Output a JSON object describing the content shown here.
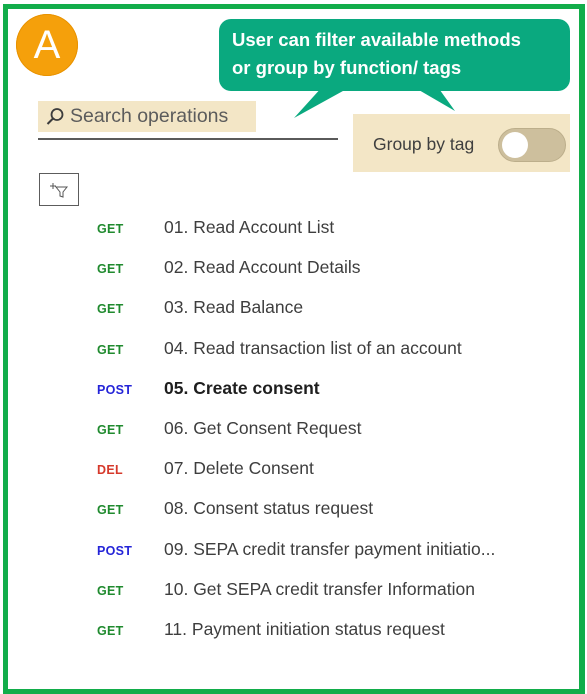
{
  "colors": {
    "frame": "#12ad4a",
    "badge": "#f5a00b",
    "callout": "#0aa97f",
    "highlight": "#f3e6c6",
    "method_get": "#1f8a2e",
    "method_post": "#2424d8",
    "method_del": "#d6392b"
  },
  "badge": {
    "label": "A"
  },
  "callout": {
    "line1": "User can filter available methods",
    "line2": "or group by function/ tags"
  },
  "search": {
    "placeholder": "Search operations",
    "value": "",
    "icon": "search-icon"
  },
  "group_by_tag": {
    "label": "Group by tag",
    "enabled": false
  },
  "filter_button": {
    "icon": "add-filter-icon"
  },
  "operations": [
    {
      "method": "GET",
      "label": "01. Read Account List",
      "selected": false
    },
    {
      "method": "GET",
      "label": "02. Read Account Details",
      "selected": false
    },
    {
      "method": "GET",
      "label": "03. Read Balance",
      "selected": false
    },
    {
      "method": "GET",
      "label": "04. Read transaction list of an account",
      "selected": false
    },
    {
      "method": "POST",
      "label": "05. Create consent",
      "selected": true
    },
    {
      "method": "GET",
      "label": "06. Get Consent Request",
      "selected": false
    },
    {
      "method": "DEL",
      "label": "07. Delete Consent",
      "selected": false
    },
    {
      "method": "GET",
      "label": "08. Consent status request",
      "selected": false
    },
    {
      "method": "POST",
      "label": "09. SEPA credit transfer payment initiatio...",
      "selected": false
    },
    {
      "method": "GET",
      "label": "10. Get SEPA credit transfer Information",
      "selected": false
    },
    {
      "method": "GET",
      "label": "11. Payment initiation status request",
      "selected": false
    }
  ]
}
